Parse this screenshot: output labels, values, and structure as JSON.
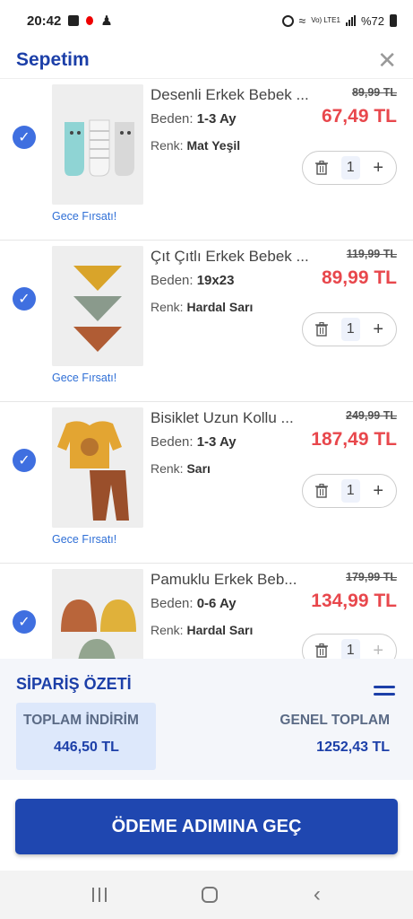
{
  "status_bar": {
    "time": "20:42",
    "network": "Vo) LTE1",
    "battery": "%72"
  },
  "header": {
    "title": "Sepetim"
  },
  "cart": {
    "items": [
      {
        "name": "Desenli Erkek Bebek ...",
        "size_label": "Beden:",
        "size": "1-3 Ay",
        "color_label": "Renk:",
        "color": "Mat Yeşil",
        "old_price": "89,99 TL",
        "price": "67,49 TL",
        "quantity": "1",
        "badge": "Gece Fırsatı!"
      },
      {
        "name": "Çıt Çıtlı Erkek Bebek ...",
        "size_label": "Beden:",
        "size": "19x23",
        "color_label": "Renk:",
        "color": "Hardal Sarı",
        "old_price": "119,99 TL",
        "price": "89,99 TL",
        "quantity": "1",
        "badge": "Gece Fırsatı!"
      },
      {
        "name": "Bisiklet Uzun Kollu ...",
        "size_label": "Beden:",
        "size": "1-3 Ay",
        "color_label": "Renk:",
        "color": "Sarı",
        "old_price": "249,99 TL",
        "price": "187,49 TL",
        "quantity": "1",
        "badge": "Gece Fırsatı!"
      },
      {
        "name": "Pamuklu Erkek Beb...",
        "size_label": "Beden:",
        "size": "0-6 Ay",
        "color_label": "Renk:",
        "color": "Hardal Sarı",
        "old_price": "179,99 TL",
        "price": "134,99 TL",
        "quantity": "1"
      }
    ]
  },
  "summary": {
    "title": "SİPARİŞ ÖZETİ",
    "discount_label": "TOPLAM İNDİRİM",
    "discount_value": "446,50 TL",
    "total_label": "GENEL TOPLAM",
    "total_value": "1252,43 TL"
  },
  "checkout": {
    "label": "ÖDEME ADIMINA GEÇ"
  },
  "colors": {
    "brand": "#1c3fa8",
    "price_red": "#e8474c",
    "check_blue": "#3f6fe0",
    "deal_blue": "#2f6fd6"
  }
}
